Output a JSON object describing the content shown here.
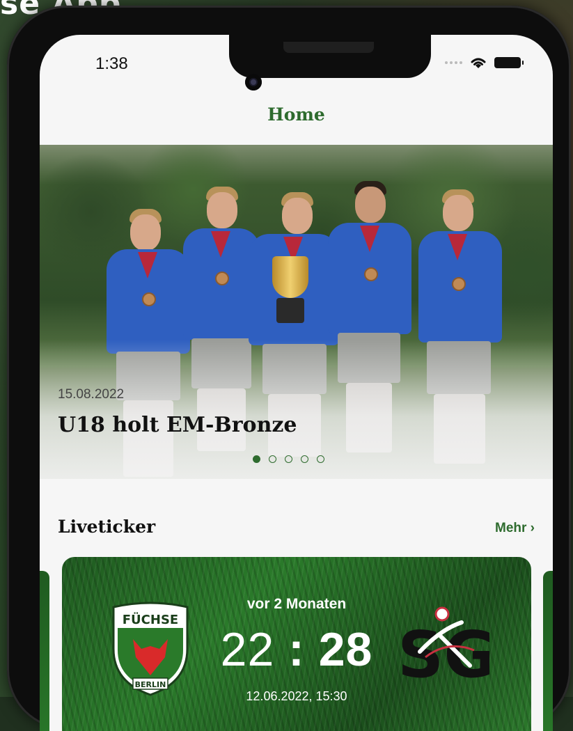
{
  "backdrop": {
    "title": "se App"
  },
  "status_bar": {
    "time": "1:38"
  },
  "header": {
    "title": "Home"
  },
  "hero": {
    "date": "15.08.2022",
    "headline": "U18 holt EM-Bronze",
    "slides": 5,
    "active_slide": 1
  },
  "liveticker": {
    "title": "Liveticker",
    "more_label": "Mehr ›",
    "match": {
      "relative_time": "vor 2 Monaten",
      "home_score": "22",
      "separator": ":",
      "away_score": "28",
      "datetime": "12.06.2022, 15:30",
      "home_team_crest_text": "FÜCHSE",
      "home_team_crest_subtext": "BERLIN",
      "away_team_logo_text": "SG"
    }
  },
  "colors": {
    "accent_green": "#2e6b2e",
    "card_green": "#2a7a2a",
    "jersey_blue": "#2f5fc0"
  }
}
